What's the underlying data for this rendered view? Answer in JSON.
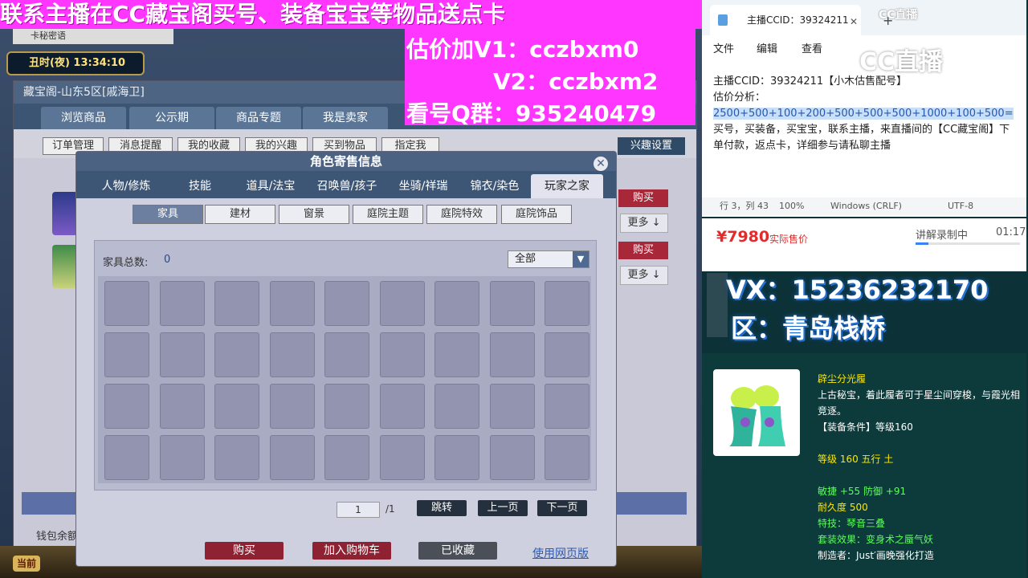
{
  "banner": {
    "headline": "联系主播在CC藏宝阁买号、装备宝宝等物品送点卡",
    "price_v1": "估价加V1：cczbxm0",
    "price_v2": "V2：cczbxm2",
    "qq_group": "看号Q群：935240479"
  },
  "game": {
    "tab_label": "卡秘密语",
    "clock": "丑时(夜)  13:34:10",
    "shop": {
      "title": "藏宝阁-山东5区[戚海卫]",
      "tabs": [
        "浏览商品",
        "公示期",
        "商品专题",
        "我是卖家"
      ],
      "subtabs": [
        "订单管理",
        "消息提醒",
        "我的收藏",
        "我的兴趣",
        "买到物品",
        "指定我"
      ],
      "interest_btn": "兴趣设置",
      "buy_label": "购买",
      "more_label": "更多 ↓",
      "wallet": "钱包余额"
    },
    "dangqian": "当前"
  },
  "dialog": {
    "title": "角色寄售信息",
    "tabs": [
      "人物/修炼",
      "技能",
      "道具/法宝",
      "召唤兽/孩子",
      "坐骑/祥瑞",
      "锦衣/染色",
      "玩家之家"
    ],
    "active_tab": "玩家之家",
    "filter_tabs": [
      "家具",
      "建材",
      "窗景",
      "庭院主题",
      "庭院特效",
      "庭院饰品"
    ],
    "active_filter": "家具",
    "furniture_count_label": "家具总数:",
    "furniture_count": "0",
    "category_filter": "全部",
    "page_current": "1",
    "page_total": "/1",
    "jump": "跳转",
    "prev": "上一页",
    "next": "下一页",
    "buy": "购买",
    "add_cart": "加入购物车",
    "collected": "已收藏",
    "web_link": "使用网页版"
  },
  "notepad": {
    "tab_title": "主播CCID：39324211",
    "menu": [
      "文件",
      "编辑",
      "查看"
    ],
    "lines": [
      "主播CCID：39324211【小木估售配号】",
      "估价分析：",
      "2500+500+100+200+500+500+500+1000+100+500=",
      "买号，买装备，买宝宝，联系主播，来直播间的【CC藏宝阁】下单付款，返点卡，详细参与请私聊主播"
    ],
    "status": {
      "position": "行 3，列 43",
      "zoom": "100%",
      "eol": "Windows (CRLF)",
      "encoding": "UTF-8"
    }
  },
  "stream": {
    "logo_small": "CC直播",
    "logo_big": "CC直播",
    "price": "¥7980",
    "price_label": "实际售价",
    "recording_label": "讲解录制中",
    "recording_time": "01:17",
    "recording_progress": 0.12,
    "vx": "VX：15236232170",
    "zone": "区：青岛栈桥"
  },
  "item": {
    "name": "辟尘分光履",
    "desc": "上古秘宝，着此履者可于星尘间穿梭，与霞光相竞逐。",
    "requirement": "【装备条件】等级160",
    "level": "等级 160  五行 土",
    "stats": "敏捷 +55 防御 +91",
    "durability": "耐久度 500",
    "special": "特技：琴音三叠",
    "set": "套装效果：变身术之蜃气妖",
    "maker": "制造者：Just′画晚强化打造"
  },
  "colors": {
    "banner_bg": "#ff36ff",
    "price_red": "#e42a2a",
    "item_name_yellow": "#ffe600",
    "stat_green": "#5aff5a"
  }
}
